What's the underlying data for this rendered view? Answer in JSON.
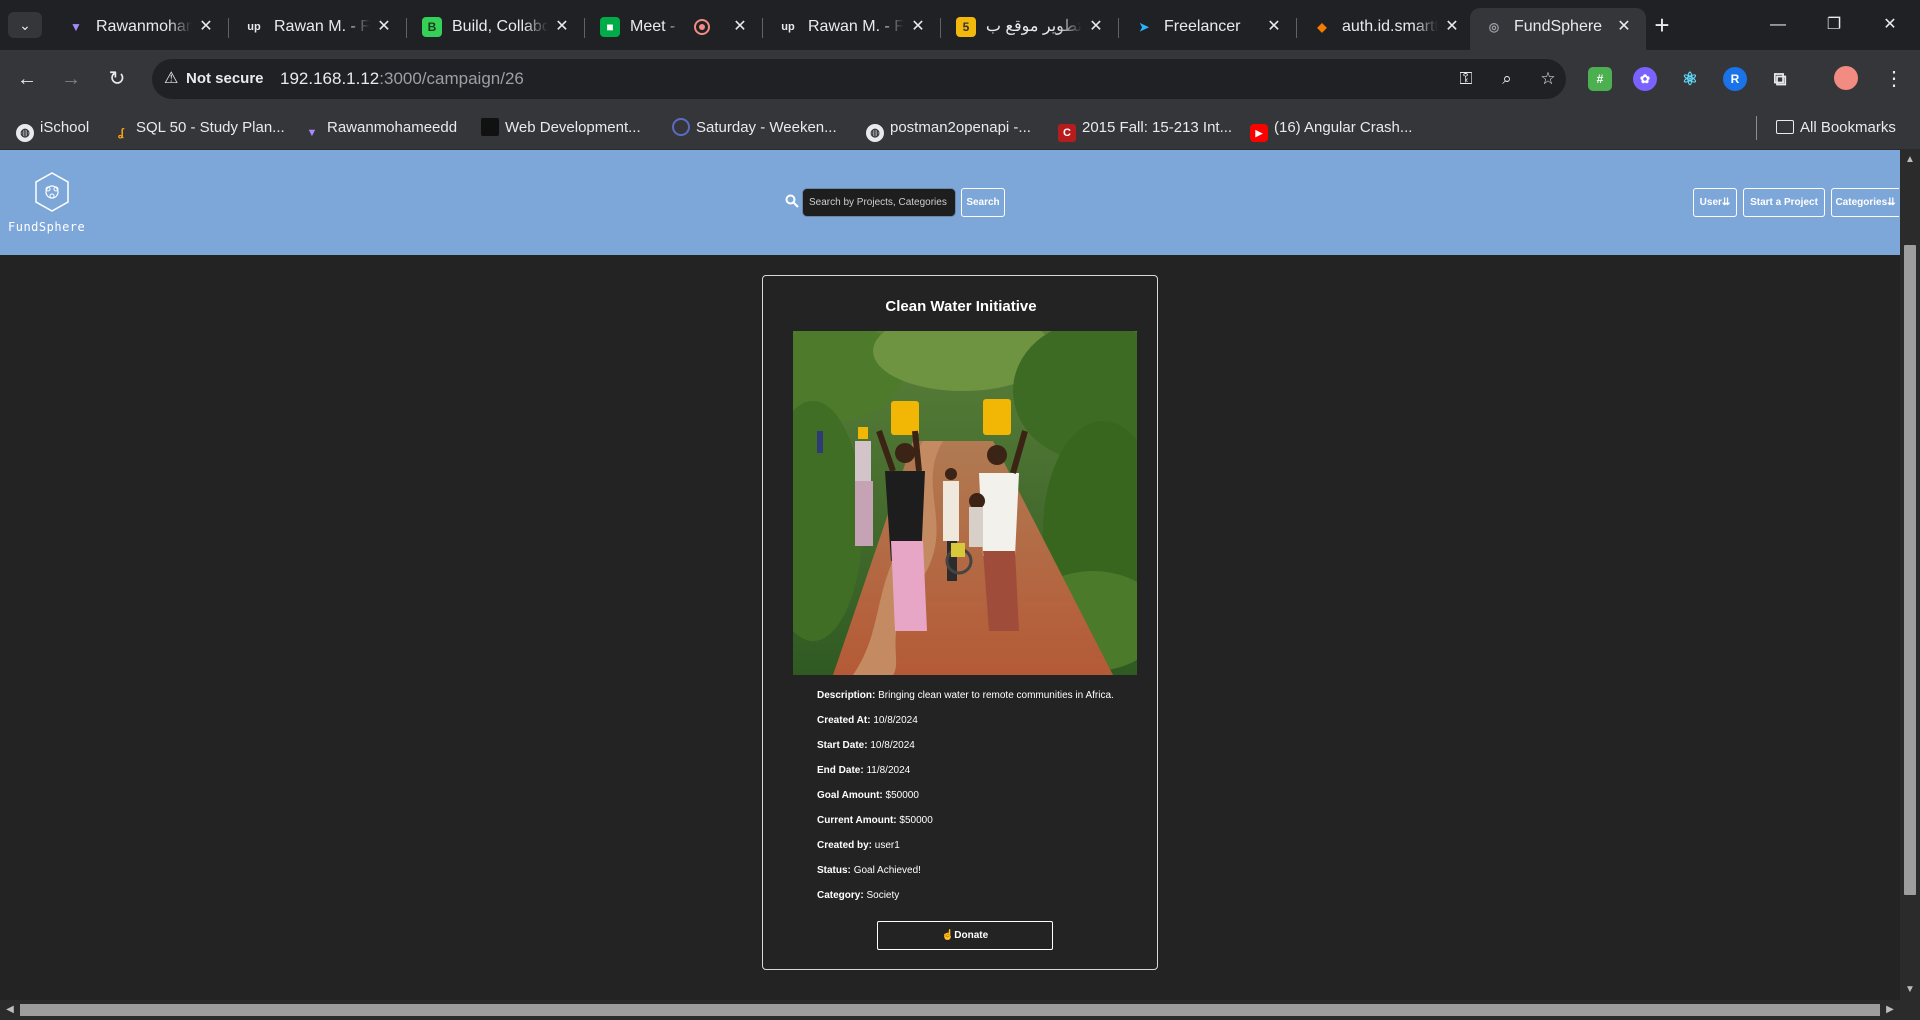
{
  "browser": {
    "tabs": [
      {
        "title": "Rawanmohamed",
        "favicon": "vite-icon",
        "color": "#a78bfa",
        "active": false
      },
      {
        "title": "Rawan M. - Full",
        "favicon": "upwork-icon",
        "color": "#e8eaed",
        "active": false
      },
      {
        "title": "Build, Collaborate",
        "favicon": "build-icon",
        "color": "#34d058",
        "active": false
      },
      {
        "title": "Meet - m",
        "favicon": "meet-icon",
        "color": "#00ac47",
        "active": false,
        "recording": true
      },
      {
        "title": "Rawan M. - Full",
        "favicon": "upwork-icon",
        "color": "#e8eaed",
        "active": false
      },
      {
        "title": "تطوير موقع ب",
        "favicon": "five-icon",
        "color": "#f2b90c",
        "active": false
      },
      {
        "title": "Freelancer",
        "favicon": "freelancer-icon",
        "color": "#29b2fe",
        "active": false
      },
      {
        "title": "auth.id.smartt",
        "favicon": "auth-icon",
        "color": "#f57c00",
        "active": false
      },
      {
        "title": "FundSphere",
        "favicon": "fundsphere-icon",
        "color": "#9aa0a6",
        "active": true
      }
    ],
    "address": {
      "security_label": "Not secure",
      "host": "192.168.1.12",
      "path": ":3000/campaign/26"
    },
    "bookmarks": [
      {
        "label": "iSchool",
        "icon": "globe-icon"
      },
      {
        "label": "SQL 50 - Study Plan...",
        "icon": "leetcode-icon"
      },
      {
        "label": "Rawanmohameedd",
        "icon": "vite-icon"
      },
      {
        "label": "Web Development...",
        "icon": "page-icon"
      },
      {
        "label": "Saturday - Weeken...",
        "icon": "calendar-icon"
      },
      {
        "label": "postman2openapi -...",
        "icon": "globe-icon"
      },
      {
        "label": "2015 Fall: 15-213 Int...",
        "icon": "c-icon"
      },
      {
        "label": "(16) Angular Crash...",
        "icon": "youtube-icon"
      }
    ],
    "all_bookmarks_label": "All Bookmarks"
  },
  "site": {
    "logo_text": "FundSphere",
    "search": {
      "placeholder": "Search by Projects, Categories",
      "button_label": "Search"
    },
    "nav": {
      "user_label": "User",
      "start_project_label": "Start a Project",
      "categories_label": "Categories"
    }
  },
  "campaign": {
    "title": "Clean Water Initiative",
    "image_alt": "People carrying water containers on a dirt road",
    "fields": [
      {
        "label": "Description:",
        "value": "Bringing clean water to remote communities in Africa."
      },
      {
        "label": "Created At:",
        "value": "10/8/2024"
      },
      {
        "label": "Start Date:",
        "value": "10/8/2024"
      },
      {
        "label": "End Date:",
        "value": "11/8/2024"
      },
      {
        "label": "Goal Amount:",
        "value": "$50000"
      },
      {
        "label": "Current Amount:",
        "value": "$50000"
      },
      {
        "label": "Created by:",
        "value": "user1"
      },
      {
        "label": "Status:",
        "value": "Goal Achieved!"
      },
      {
        "label": "Category:",
        "value": "Society"
      }
    ],
    "donate_label": "Donate"
  },
  "colors": {
    "header_bg": "#7da7d9",
    "page_bg": "#232323",
    "browser_chrome": "#35363a"
  }
}
